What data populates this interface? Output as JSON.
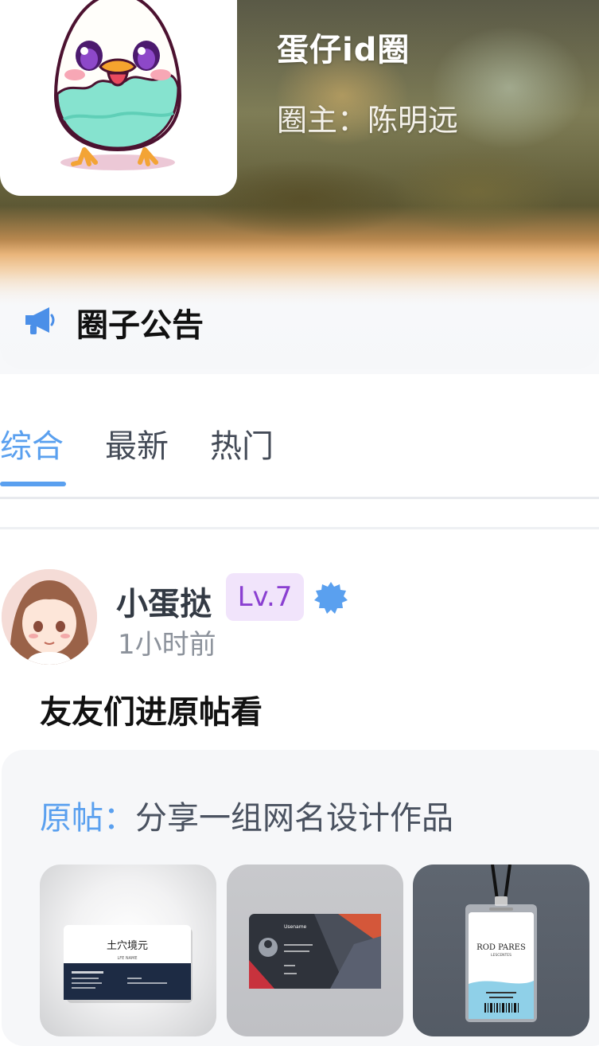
{
  "header": {
    "circle_title": "蛋仔id圈",
    "owner_label": "圈主：陈明远"
  },
  "notice": {
    "label": "圈子公告"
  },
  "tabs": [
    {
      "label": "综合",
      "active": true
    },
    {
      "label": "最新",
      "active": false
    },
    {
      "label": "热门",
      "active": false
    }
  ],
  "post": {
    "username": "小蛋挞",
    "level": "Lv.7",
    "time": "1小时前",
    "text": "友友们进原帖看",
    "origin_prefix": "原帖：",
    "origin_title": "分享一组网名设计作品",
    "thumbnails": [
      {
        "card_title": "土穴境元",
        "card_sub": "LFE NAME"
      },
      {
        "card_title": "Usename"
      },
      {
        "card_title": "ROD PARES",
        "card_sub": "LESCENTES"
      }
    ]
  },
  "colors": {
    "accent": "#5aa0ef",
    "level_bg": "#f1e4fb",
    "level_text": "#8a3fd1"
  },
  "icons": {
    "notice": "megaphone-icon",
    "verify": "verified-badge-icon"
  }
}
